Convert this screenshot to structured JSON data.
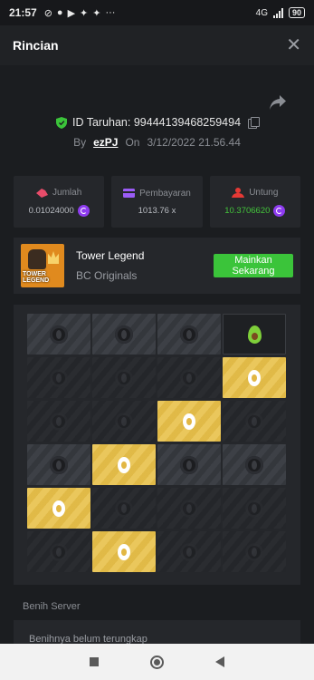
{
  "statusbar": {
    "time": "21:57",
    "icons": [
      "dnd-icon",
      "pinterest-icon",
      "youtube-icon",
      "twitter-icon",
      "twitter-icon",
      "more-icon"
    ],
    "network": "4G",
    "battery": "90"
  },
  "header": {
    "title": "Rincian"
  },
  "bet": {
    "id_label": "ID Taruhan: 99444139468259494",
    "by_label": "By",
    "user": "ezPJ",
    "on_label": "On",
    "date": "3/12/2022 21.56.44"
  },
  "stats": [
    {
      "label": "Jumlah",
      "value": "0.01024000",
      "icon": "money-icon"
    },
    {
      "label": "Pembayaran",
      "value": "1013.76 x",
      "icon": "card-icon"
    },
    {
      "label": "Untung",
      "value": "10.3706620",
      "icon": "profit-icon"
    }
  ],
  "game": {
    "name": "Tower Legend",
    "provider": "BC Originals",
    "thumb_text": "TOWER LEGEND",
    "play_label": "Mainkan Sekarang"
  },
  "board": {
    "rows": [
      [
        "stone",
        "stone",
        "stone",
        "avocado"
      ],
      [
        "dim",
        "dim",
        "dim",
        "gold"
      ],
      [
        "dim",
        "dim",
        "gold",
        "dim"
      ],
      [
        "stone",
        "gold",
        "stone",
        "stone"
      ],
      [
        "gold",
        "dim",
        "dim",
        "dim"
      ],
      [
        "dim",
        "gold",
        "dim",
        "dim"
      ]
    ]
  },
  "seed": {
    "label": "Benih Server",
    "value": "Benihnya belum terungkap"
  },
  "colors": {
    "background": "#1b1d20",
    "panel": "#25272b",
    "accent_green": "#3bc43a",
    "gold_tile": "#e8c24e",
    "coin_purple": "#8e3cf0"
  }
}
